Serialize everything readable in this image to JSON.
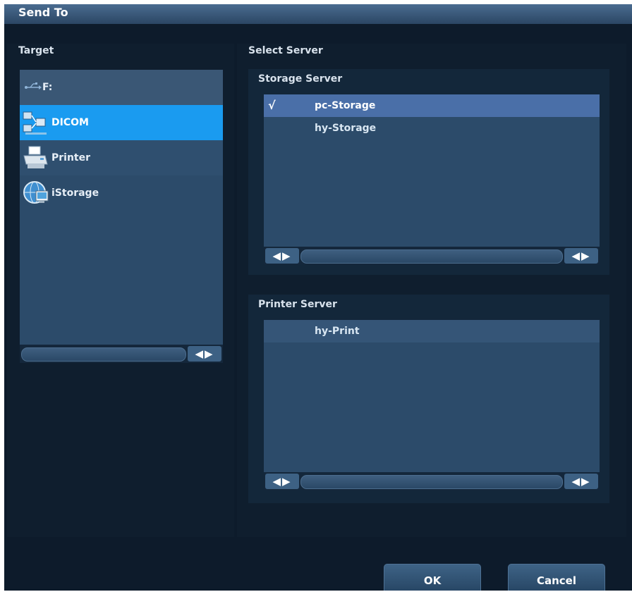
{
  "dialog": {
    "title": "Send To"
  },
  "target": {
    "heading": "Target",
    "items": [
      {
        "label": "F:",
        "icon": "usb-icon"
      },
      {
        "label": "DICOM",
        "icon": "dicom-network-icon"
      },
      {
        "label": "Printer",
        "icon": "printer-icon"
      },
      {
        "label": "iStorage",
        "icon": "istorage-icon"
      }
    ],
    "selected_index": 1
  },
  "select_server": {
    "heading": "Select Server",
    "storage_server": {
      "heading": "Storage Server",
      "rows": [
        {
          "check": "√",
          "name": "pc-Storage",
          "selected": true
        },
        {
          "check": "",
          "name": "hy-Storage",
          "selected": false
        }
      ]
    },
    "printer_server": {
      "heading": "Printer Server",
      "rows": [
        {
          "check": "",
          "name": "hy-Print",
          "selected": false
        }
      ]
    }
  },
  "scroll": {
    "arrows": "◀▶"
  },
  "buttons": {
    "ok": "OK",
    "cancel": "Cancel"
  },
  "colors": {
    "background": "#0d1b2b",
    "list": "#2c4b6a",
    "selected_item": "#1a9bf0",
    "selected_row": "#4a6fa8"
  }
}
